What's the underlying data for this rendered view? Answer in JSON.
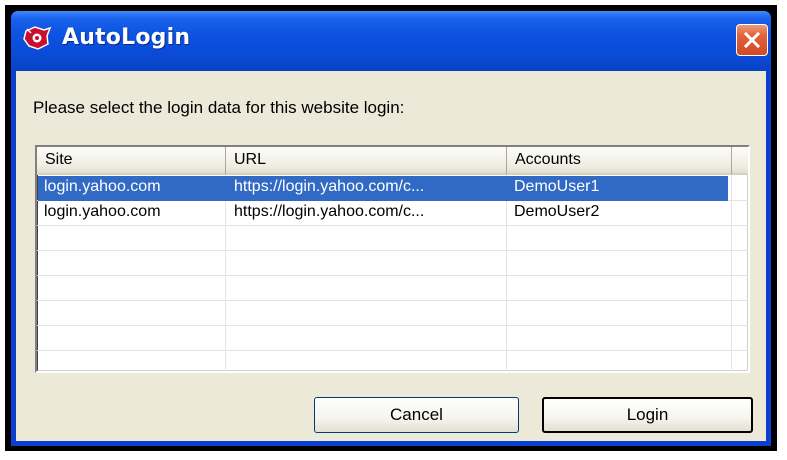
{
  "window": {
    "title": "AutoLogin",
    "close_tooltip": "Close"
  },
  "dialog": {
    "prompt": "Please select the login data for this website login:"
  },
  "list": {
    "columns": [
      "Site",
      "URL",
      "Accounts"
    ],
    "rows": [
      {
        "site": "login.yahoo.com",
        "url": "https://login.yahoo.com/c...",
        "account": "DemoUser1",
        "selected": true
      },
      {
        "site": "login.yahoo.com",
        "url": "https://login.yahoo.com/c...",
        "account": "DemoUser2",
        "selected": false
      }
    ]
  },
  "buttons": {
    "cancel_label": "Cancel",
    "login_label": "Login"
  },
  "colors": {
    "titlebar": "#0a4bd8",
    "selection": "#316ac5",
    "dialog_face": "#ece9d8",
    "close_button": "#e1623a"
  },
  "icons": {
    "app": "autologin-icon",
    "close": "close-icon"
  }
}
